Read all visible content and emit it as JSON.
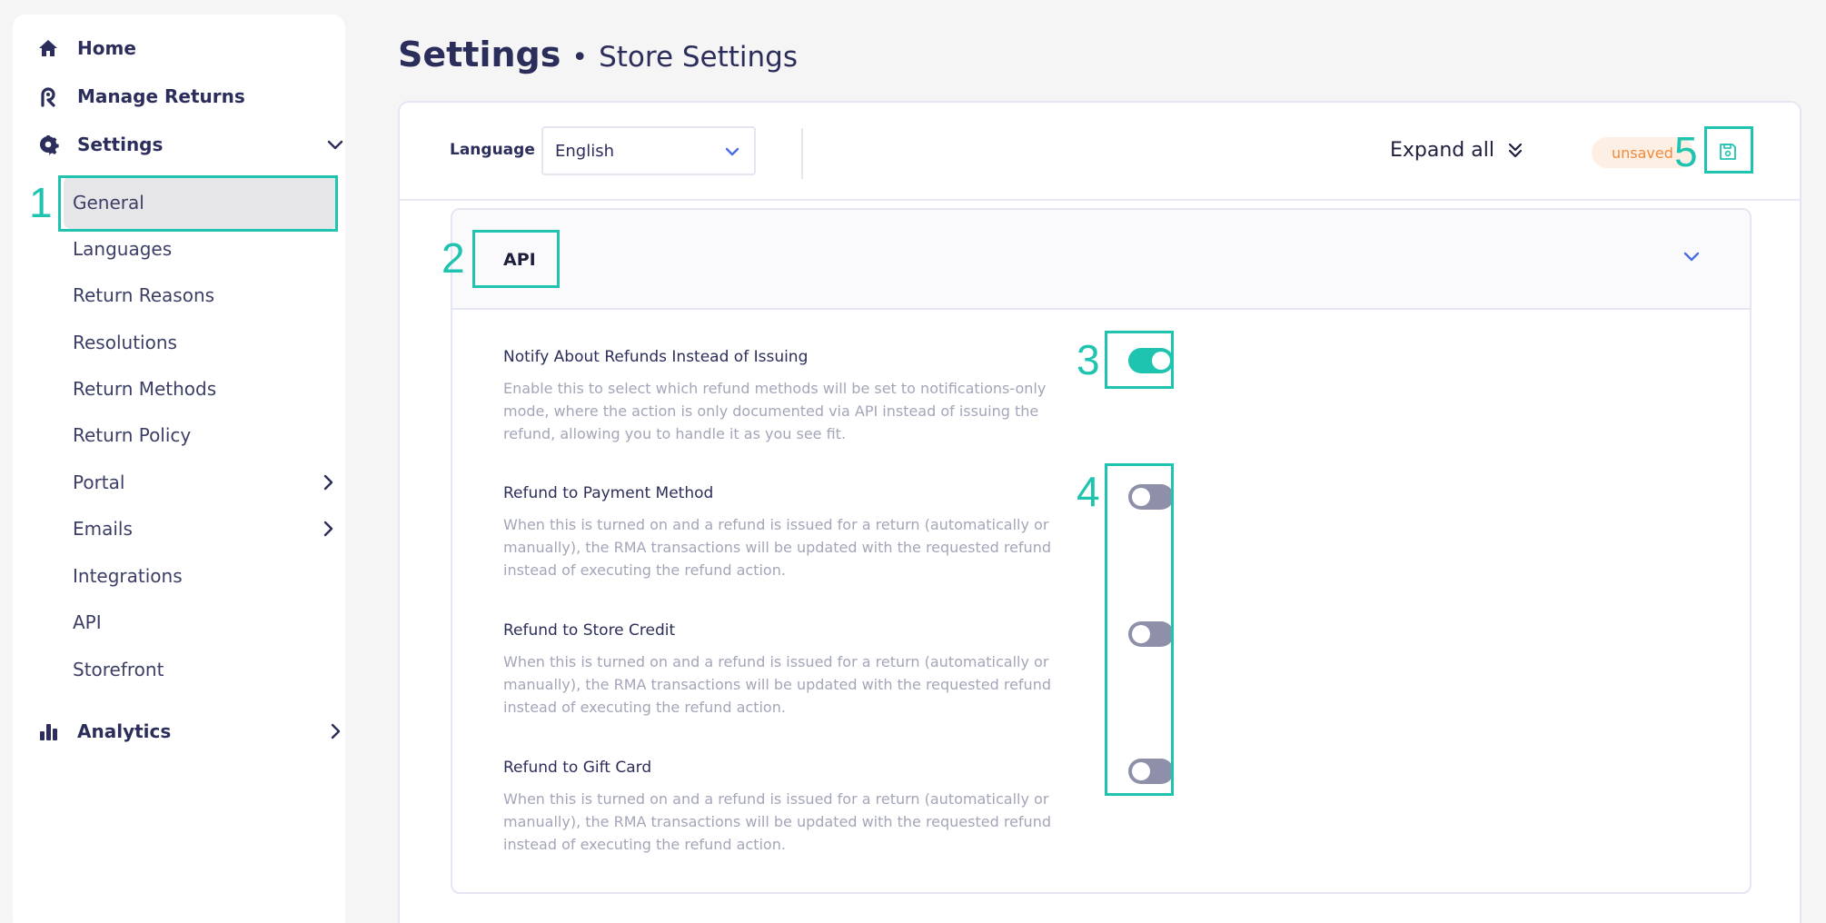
{
  "sidebar": {
    "home": "Home",
    "manage_returns": "Manage Returns",
    "settings": "Settings",
    "settings_items": [
      "General",
      "Languages",
      "Return Reasons",
      "Resolutions",
      "Return Methods",
      "Return Policy",
      "Portal",
      "Emails",
      "Integrations",
      "API",
      "Storefront"
    ],
    "analytics": "Analytics"
  },
  "header": {
    "title": "Settings",
    "separator": "•",
    "subtitle": "Store Settings"
  },
  "toolbar": {
    "language_label": "Language",
    "language_value": "English",
    "expand_all": "Expand all",
    "unsaved": "unsaved"
  },
  "section": {
    "title": "API",
    "settings": [
      {
        "label": "Notify About Refunds Instead of Issuing",
        "description": "Enable this to select which refund methods will be set to notifications-only mode, where the action is only documented via API instead of issuing the refund, allowing you to handle it as you see fit.",
        "enabled": true
      },
      {
        "label": "Refund to Payment Method",
        "description": "When this is turned on and a refund is issued for a return (automatically or manually), the RMA transactions will be updated with the requested refund instead of executing the refund action.",
        "enabled": false
      },
      {
        "label": "Refund to Store Credit",
        "description": "When this is turned on and a refund is issued for a return (automatically or manually), the RMA transactions will be updated with the requested refund instead of executing the refund action.",
        "enabled": false
      },
      {
        "label": "Refund to Gift Card",
        "description": "When this is turned on and a refund is issued for a return (automatically or manually), the RMA transactions will be updated with the requested refund instead of executing the refund action.",
        "enabled": false
      }
    ]
  },
  "callouts": [
    "1",
    "2",
    "3",
    "4",
    "5"
  ],
  "colors": {
    "accent": "#1ec4b0",
    "navy": "#2b2e5a",
    "unsaved_text": "#f08a3c",
    "unsaved_bg": "#fdefe3",
    "toggle_off": "#8e8fa9"
  }
}
